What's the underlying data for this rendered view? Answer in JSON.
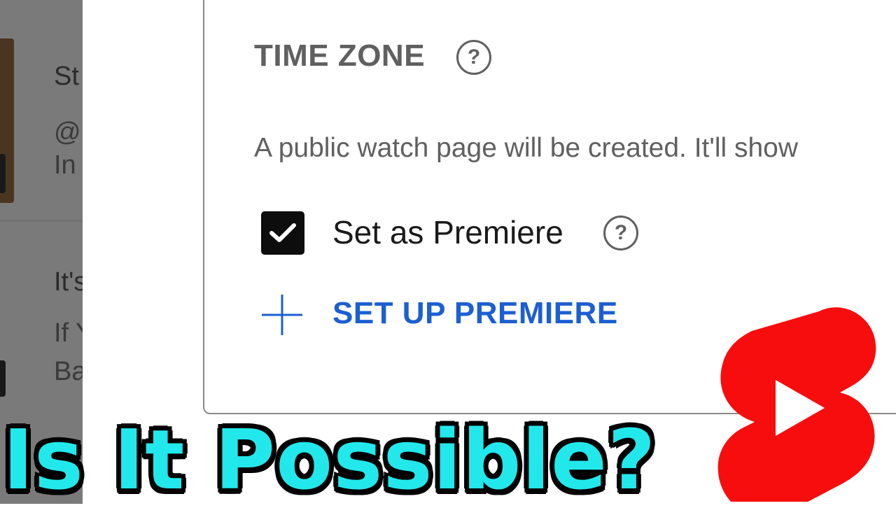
{
  "background_list": {
    "item1_title": "St",
    "item1_handle": "@",
    "item1_sub": "In",
    "item2_title": "It's",
    "item2_line1": "If Y",
    "item2_line2": "Ba"
  },
  "schedule_card": {
    "time_zone_label": "TIME ZONE",
    "help_glyph": "?",
    "description": "A public watch page will be created. It'll show",
    "premiere_checkbox_label": "Set as Premiere",
    "premiere_checked": true,
    "setup_premiere_label": "SET UP PREMIERE"
  },
  "overlay": {
    "title": "Is It Possible?",
    "title_color": "#22e8ec",
    "logo": "youtube-shorts-icon",
    "logo_color": "#f70d0d"
  },
  "colors": {
    "accent_blue": "#1c5fd2",
    "dim_panel": "#7a7a7a"
  }
}
